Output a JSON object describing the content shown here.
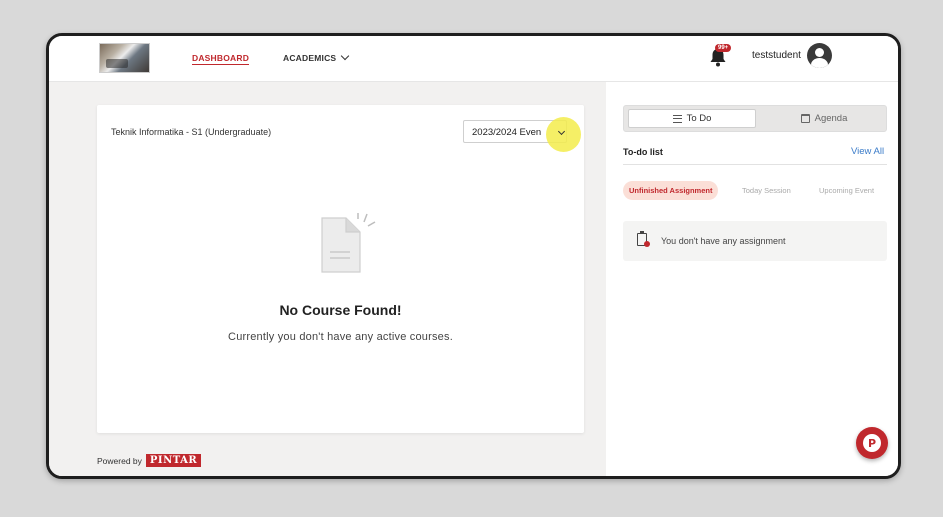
{
  "navbar": {
    "dashboard_label": "DASHBOARD",
    "academics_label": "ACADEMICS",
    "notification_count": "99+",
    "username": "teststudent"
  },
  "course_panel": {
    "program": "Teknik Informatika - S1 (Undergraduate)",
    "semester_selected": "2023/2024 Even",
    "empty_title": "No Course Found!",
    "empty_message": "Currently you don't have any active courses."
  },
  "footer": {
    "powered_by": "Powered by",
    "brand": "PINTAR"
  },
  "sidebar": {
    "tabs": [
      {
        "label": "To Do",
        "icon": "list-icon",
        "active": true
      },
      {
        "label": "Agenda",
        "icon": "calendar-icon",
        "active": false
      }
    ],
    "list_title": "To-do list",
    "view_all": "View All",
    "filters": [
      {
        "label": "Unfinished Assignment",
        "active": true
      },
      {
        "label": "Today Session",
        "active": false
      },
      {
        "label": "Upcoming Event",
        "active": false
      }
    ],
    "empty_assignment": "You don't have any assignment",
    "help_fab_letter": "P"
  },
  "colors": {
    "brand_red": "#c0282d",
    "link_blue": "#3b7cc9",
    "highlight_yellow": "#f3ec4b"
  }
}
